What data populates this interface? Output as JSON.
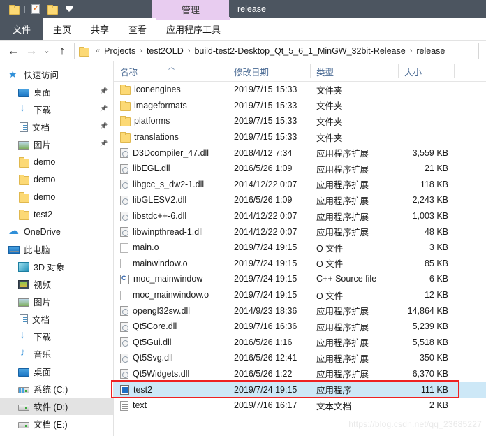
{
  "titlebar": {
    "qat_icons": [
      "folder-icon",
      "properties-icon",
      "new-folder-icon",
      "customize-dropdown-icon"
    ],
    "context_tab": "管理",
    "window_title": "release"
  },
  "ribbon": {
    "tabs": [
      {
        "label": "文件",
        "name": "tab-file",
        "active": true
      },
      {
        "label": "主页",
        "name": "tab-home",
        "active": false
      },
      {
        "label": "共享",
        "name": "tab-share",
        "active": false
      },
      {
        "label": "查看",
        "name": "tab-view",
        "active": false
      },
      {
        "label": "应用程序工具",
        "name": "tab-application-tools",
        "active": false
      }
    ]
  },
  "addressbar": {
    "back": "←",
    "forward": "→",
    "recent": "⌄",
    "up": "↑",
    "prefix": "«",
    "crumbs": [
      "Projects",
      "test2OLD",
      "build-test2-Desktop_Qt_5_6_1_MinGW_32bit-Release",
      "release"
    ],
    "separator": "›"
  },
  "sidebar": {
    "items": [
      {
        "label": "快速访问",
        "icon": "star-icon",
        "indent": 0,
        "pinned": false,
        "selected": false
      },
      {
        "label": "桌面",
        "icon": "desktop-icon",
        "indent": 1,
        "pinned": true,
        "selected": false
      },
      {
        "label": "下载",
        "icon": "download-icon",
        "indent": 1,
        "pinned": true,
        "selected": false
      },
      {
        "label": "文档",
        "icon": "documents-icon",
        "indent": 1,
        "pinned": true,
        "selected": false
      },
      {
        "label": "图片",
        "icon": "pictures-icon",
        "indent": 1,
        "pinned": true,
        "selected": false
      },
      {
        "label": "demo",
        "icon": "folder-icon",
        "indent": 1,
        "pinned": false,
        "selected": false
      },
      {
        "label": "demo",
        "icon": "folder-icon",
        "indent": 1,
        "pinned": false,
        "selected": false
      },
      {
        "label": "demo",
        "icon": "folder-icon",
        "indent": 1,
        "pinned": false,
        "selected": false
      },
      {
        "label": "test2",
        "icon": "folder-icon",
        "indent": 1,
        "pinned": false,
        "selected": false
      },
      {
        "label": "OneDrive",
        "icon": "onedrive-cloud-icon",
        "indent": 0,
        "pinned": false,
        "selected": false
      },
      {
        "label": "此电脑",
        "icon": "this-pc-icon",
        "indent": 0,
        "pinned": false,
        "selected": false
      },
      {
        "label": "3D 对象",
        "icon": "3d-objects-icon",
        "indent": 1,
        "pinned": false,
        "selected": false
      },
      {
        "label": "视频",
        "icon": "videos-icon",
        "indent": 1,
        "pinned": false,
        "selected": false
      },
      {
        "label": "图片",
        "icon": "pictures-icon",
        "indent": 1,
        "pinned": false,
        "selected": false
      },
      {
        "label": "文档",
        "icon": "documents-icon",
        "indent": 1,
        "pinned": false,
        "selected": false
      },
      {
        "label": "下载",
        "icon": "download-icon",
        "indent": 1,
        "pinned": false,
        "selected": false
      },
      {
        "label": "音乐",
        "icon": "music-icon",
        "indent": 1,
        "pinned": false,
        "selected": false
      },
      {
        "label": "桌面",
        "icon": "desktop-icon",
        "indent": 1,
        "pinned": false,
        "selected": false
      },
      {
        "label": "系统 (C:)",
        "icon": "system-drive-icon",
        "indent": 1,
        "pinned": false,
        "selected": false
      },
      {
        "label": "软件 (D:)",
        "icon": "drive-icon",
        "indent": 1,
        "pinned": false,
        "selected": true
      },
      {
        "label": "文档 (E:)",
        "icon": "drive-icon",
        "indent": 1,
        "pinned": false,
        "selected": false
      }
    ]
  },
  "filelist": {
    "columns": [
      {
        "label": "名称",
        "key": "name",
        "sorted": "asc"
      },
      {
        "label": "修改日期",
        "key": "date"
      },
      {
        "label": "类型",
        "key": "type"
      },
      {
        "label": "大小",
        "key": "size"
      }
    ],
    "sort_indicator": "︿",
    "rows": [
      {
        "name": "iconengines",
        "date": "2019/7/15 15:33",
        "type": "文件夹",
        "size": "",
        "icon": "folder-icon",
        "selected": false
      },
      {
        "name": "imageformats",
        "date": "2019/7/15 15:33",
        "type": "文件夹",
        "size": "",
        "icon": "folder-icon",
        "selected": false
      },
      {
        "name": "platforms",
        "date": "2019/7/15 15:33",
        "type": "文件夹",
        "size": "",
        "icon": "folder-icon",
        "selected": false
      },
      {
        "name": "translations",
        "date": "2019/7/15 15:33",
        "type": "文件夹",
        "size": "",
        "icon": "folder-icon",
        "selected": false
      },
      {
        "name": "D3Dcompiler_47.dll",
        "date": "2018/4/12 7:34",
        "type": "应用程序扩展",
        "size": "3,559 KB",
        "icon": "dll-icon",
        "selected": false
      },
      {
        "name": "libEGL.dll",
        "date": "2016/5/26 1:09",
        "type": "应用程序扩展",
        "size": "21 KB",
        "icon": "dll-icon",
        "selected": false
      },
      {
        "name": "libgcc_s_dw2-1.dll",
        "date": "2014/12/22 0:07",
        "type": "应用程序扩展",
        "size": "118 KB",
        "icon": "dll-icon",
        "selected": false
      },
      {
        "name": "libGLESV2.dll",
        "date": "2016/5/26 1:09",
        "type": "应用程序扩展",
        "size": "2,243 KB",
        "icon": "dll-icon",
        "selected": false
      },
      {
        "name": "libstdc++-6.dll",
        "date": "2014/12/22 0:07",
        "type": "应用程序扩展",
        "size": "1,003 KB",
        "icon": "dll-icon",
        "selected": false
      },
      {
        "name": "libwinpthread-1.dll",
        "date": "2014/12/22 0:07",
        "type": "应用程序扩展",
        "size": "48 KB",
        "icon": "dll-icon",
        "selected": false
      },
      {
        "name": "main.o",
        "date": "2019/7/24 19:15",
        "type": "O 文件",
        "size": "3 KB",
        "icon": "blank-file-icon",
        "selected": false
      },
      {
        "name": "mainwindow.o",
        "date": "2019/7/24 19:15",
        "type": "O 文件",
        "size": "85 KB",
        "icon": "blank-file-icon",
        "selected": false
      },
      {
        "name": "moc_mainwindow",
        "date": "2019/7/24 19:15",
        "type": "C++ Source file",
        "size": "6 KB",
        "icon": "cpp-source-icon",
        "selected": false
      },
      {
        "name": "moc_mainwindow.o",
        "date": "2019/7/24 19:15",
        "type": "O 文件",
        "size": "12 KB",
        "icon": "blank-file-icon",
        "selected": false
      },
      {
        "name": "opengl32sw.dll",
        "date": "2014/9/23 18:36",
        "type": "应用程序扩展",
        "size": "14,864 KB",
        "icon": "dll-icon",
        "selected": false
      },
      {
        "name": "Qt5Core.dll",
        "date": "2019/7/16 16:36",
        "type": "应用程序扩展",
        "size": "5,239 KB",
        "icon": "dll-icon",
        "selected": false
      },
      {
        "name": "Qt5Gui.dll",
        "date": "2016/5/26 1:16",
        "type": "应用程序扩展",
        "size": "5,518 KB",
        "icon": "dll-icon",
        "selected": false
      },
      {
        "name": "Qt5Svg.dll",
        "date": "2016/5/26 12:41",
        "type": "应用程序扩展",
        "size": "350 KB",
        "icon": "dll-icon",
        "selected": false
      },
      {
        "name": "Qt5Widgets.dll",
        "date": "2016/5/26 1:22",
        "type": "应用程序扩展",
        "size": "6,370 KB",
        "icon": "dll-icon",
        "selected": false
      },
      {
        "name": "test2",
        "date": "2019/7/24 19:15",
        "type": "应用程序",
        "size": "111 KB",
        "icon": "exe-icon",
        "selected": true
      },
      {
        "name": "text",
        "date": "2019/7/16 16:17",
        "type": "文本文档",
        "size": "2 KB",
        "icon": "text-file-icon",
        "selected": false
      }
    ]
  },
  "annotation": {
    "highlight_color": "#ee2222",
    "target_row": "test2"
  },
  "watermark": {
    "text": "https://blog.csdn.net/qq_23685227"
  },
  "colors": {
    "titlebar": "#4c5560",
    "context_tab": "#e8ccf0",
    "selection": "#cde8f7",
    "sidebar_selection": "#e3e3e3",
    "header_text": "#4a6a93"
  }
}
